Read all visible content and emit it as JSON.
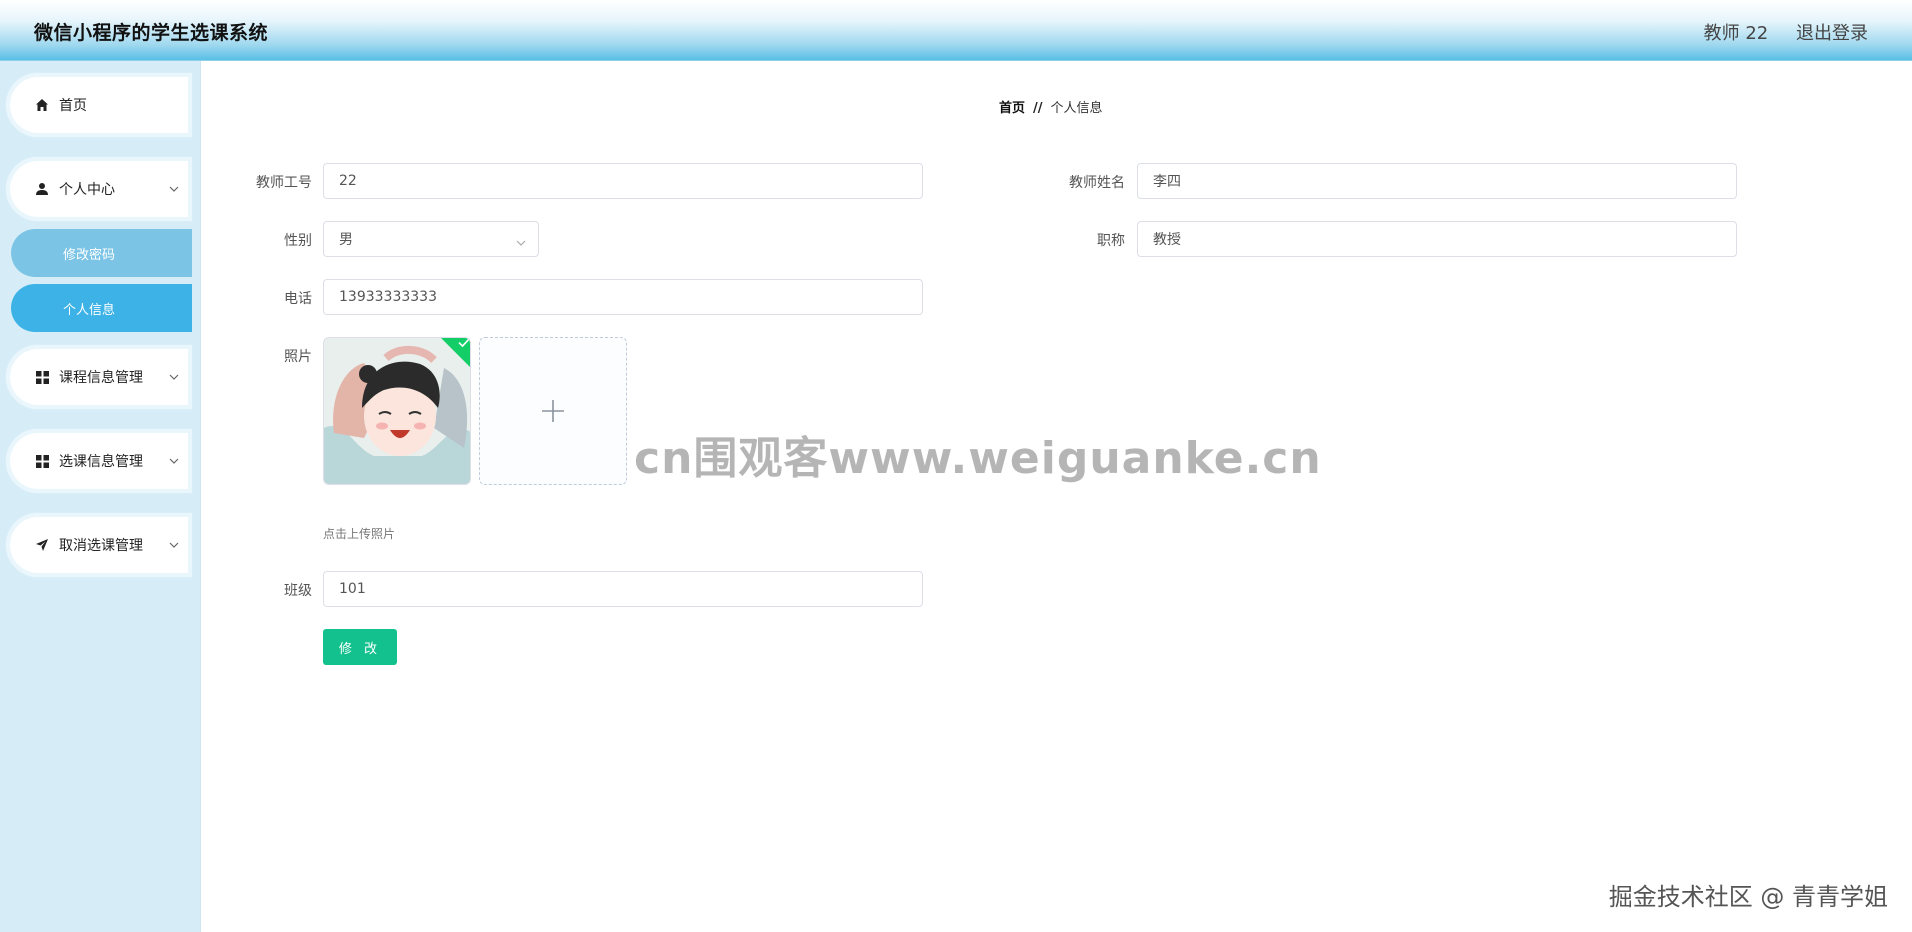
{
  "header": {
    "title": "微信小程序的学生选课系统",
    "user": "教师 22",
    "logout": "退出登录"
  },
  "sidebar": {
    "items": [
      {
        "label": "首页",
        "icon": "home-icon"
      },
      {
        "label": "个人中心",
        "icon": "user-icon",
        "expanded": true,
        "children": [
          {
            "label": "修改密码"
          },
          {
            "label": "个人信息",
            "active": true
          }
        ]
      },
      {
        "label": "课程信息管理",
        "icon": "grid-icon"
      },
      {
        "label": "选课信息管理",
        "icon": "grid-icon"
      },
      {
        "label": "取消选课管理",
        "icon": "send-icon"
      }
    ]
  },
  "breadcrumb": {
    "home": "首页",
    "separator": "//",
    "current": "个人信息"
  },
  "form": {
    "teacher_id": {
      "label": "教师工号",
      "value": "22"
    },
    "teacher_name": {
      "label": "教师姓名",
      "value": "李四"
    },
    "gender": {
      "label": "性别",
      "value": "男"
    },
    "title": {
      "label": "职称",
      "value": "教授"
    },
    "phone": {
      "label": "电话",
      "value": "13933333333"
    },
    "photo": {
      "label": "照片",
      "tip": "点击上传照片"
    },
    "class": {
      "label": "班级",
      "value": "101"
    },
    "submit_label": "修 改"
  },
  "watermarks": {
    "center": "cn围观客www.weiguanke.cn",
    "corner": "掘金技术社区 @ 青青学姐"
  },
  "colors": {
    "accent": "#3cb2e6",
    "submit": "#13c18f",
    "success": "#13ce66"
  }
}
